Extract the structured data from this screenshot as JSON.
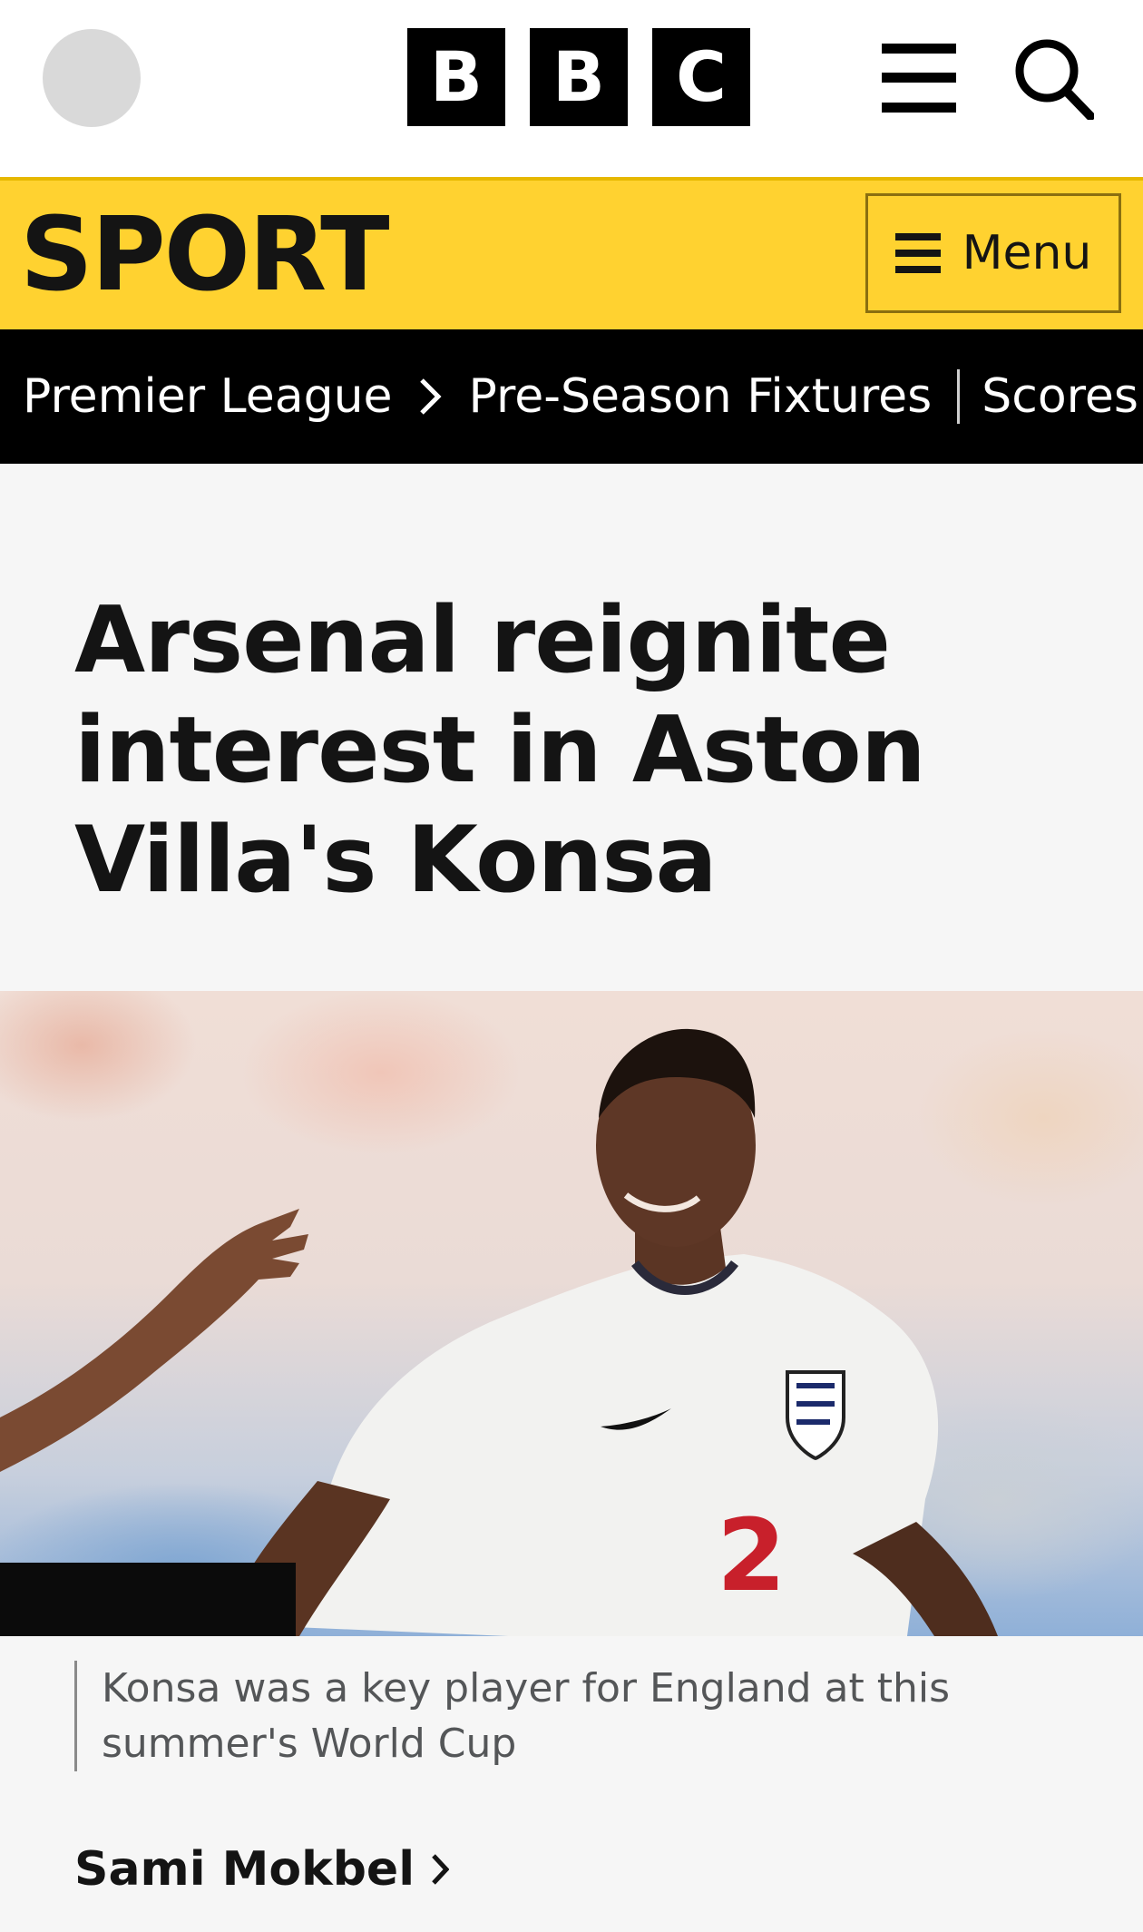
{
  "header": {
    "logo_letters": [
      "B",
      "B",
      "C"
    ],
    "avatar_icon": "avatar-placeholder",
    "menu_icon": "hamburger-icon",
    "search_icon": "search-icon"
  },
  "sport_bar": {
    "title": "SPORT",
    "menu_label": "Menu",
    "accent_color": "#ffd230"
  },
  "breadcrumb": {
    "items": [
      "Premier League",
      "Pre-Season Fixtures",
      "Scores"
    ]
  },
  "article": {
    "headline": "Arsenal reignite interest in Aston Villa's Konsa",
    "image_alt_subject": "Player in white England shirt number 2",
    "image_caption": "Konsa was a key player for England at this summer's World Cup",
    "author": "Sami Mokbel"
  }
}
